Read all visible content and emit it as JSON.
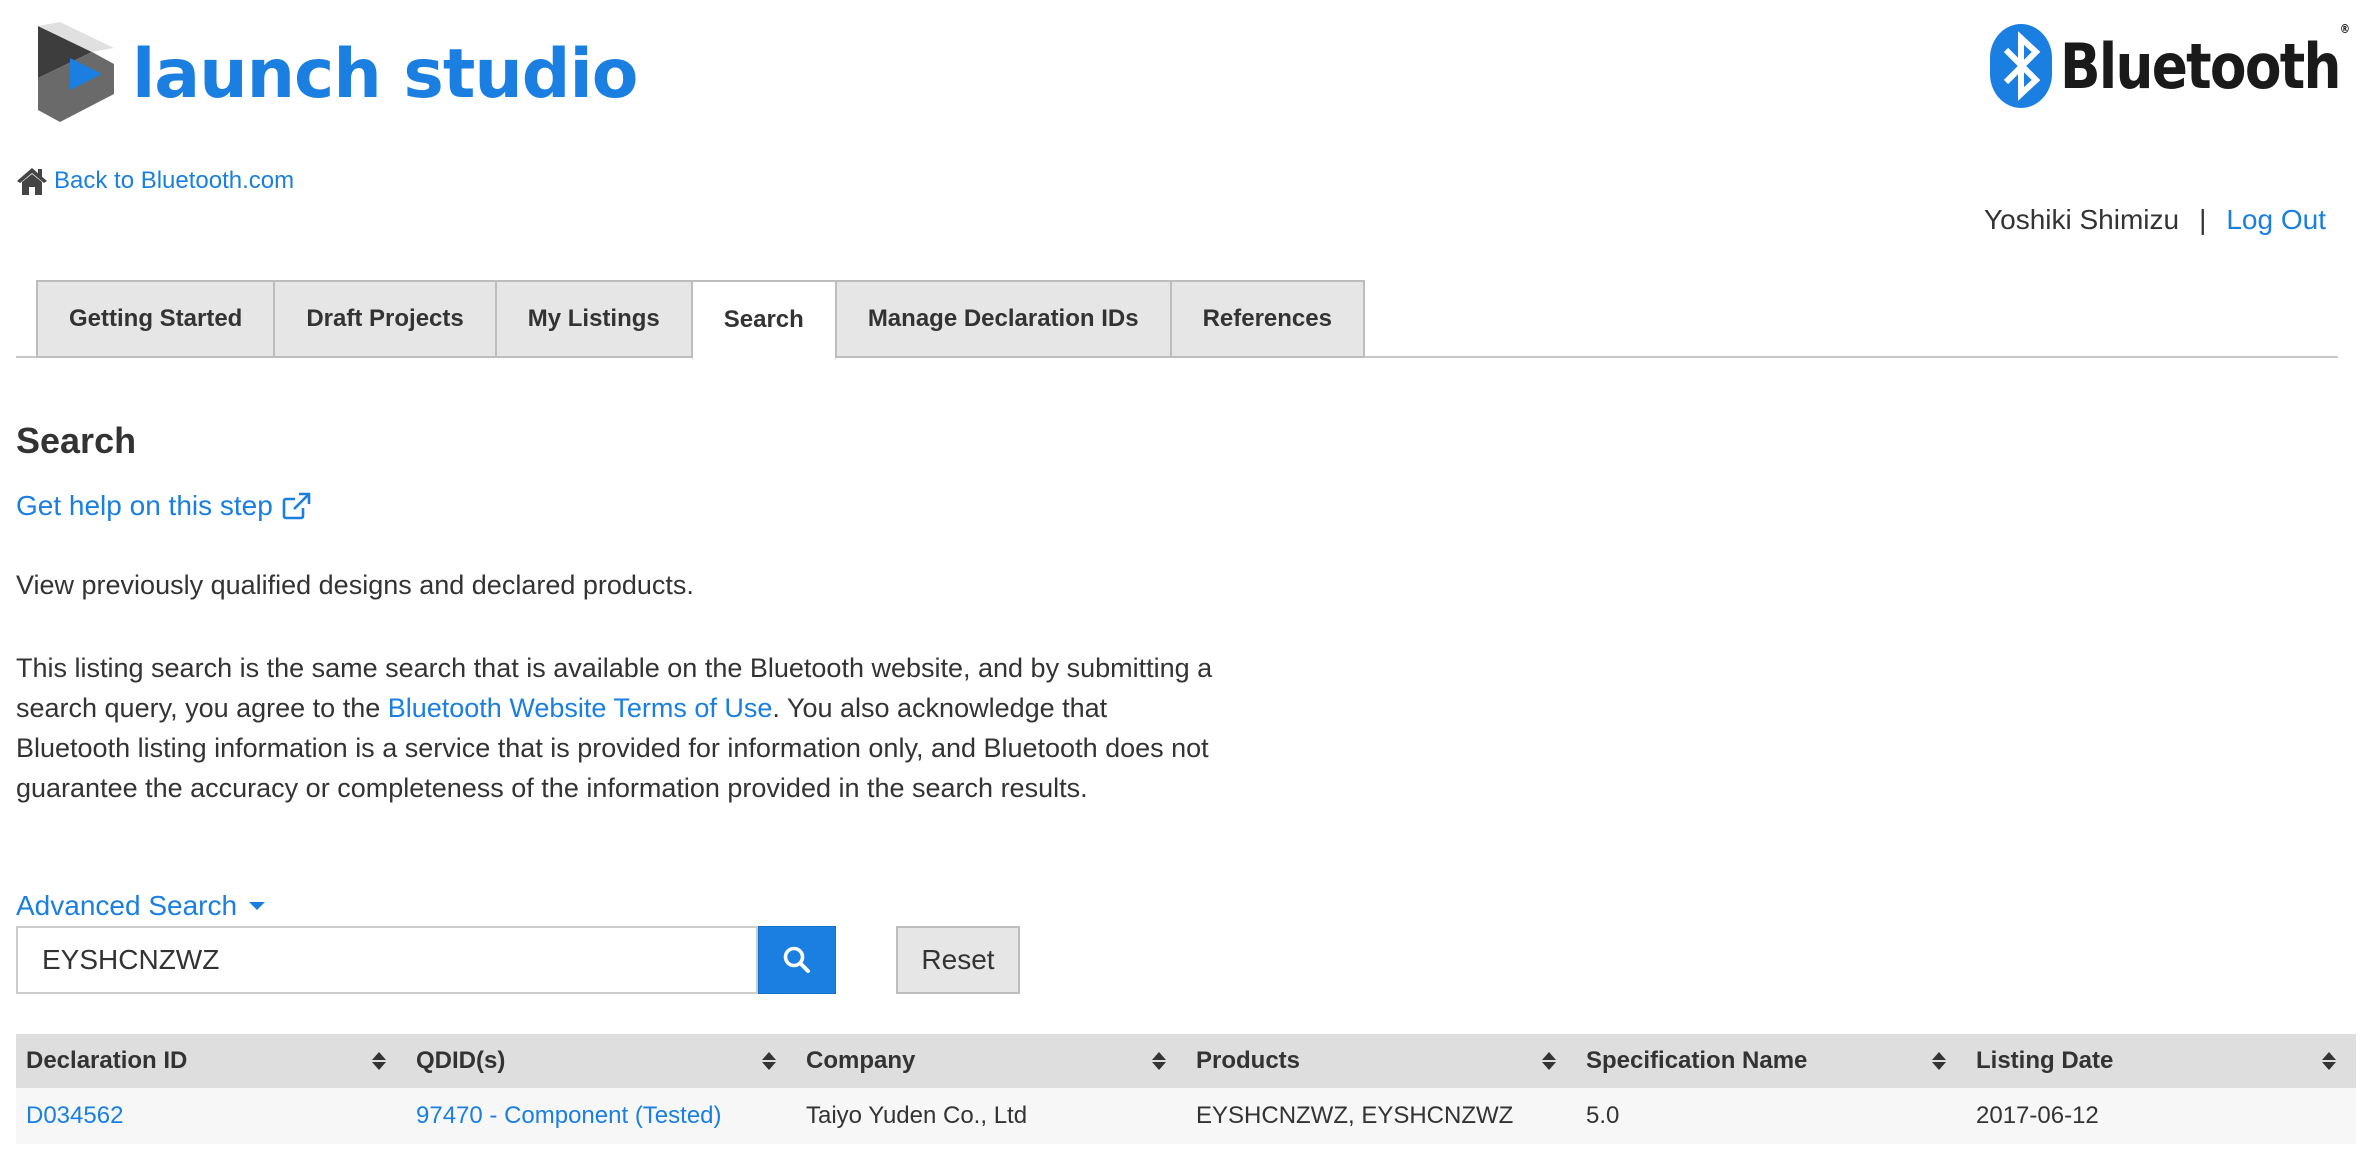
{
  "header": {
    "logo_text": "launch studio",
    "brand_logo_text": "Bluetooth",
    "brand_logo_mark": "®",
    "back_link": "Back to Bluetooth.com",
    "user_name": "Yoshiki Shimizu",
    "separator": "|",
    "logout_label": "Log Out"
  },
  "tabs": [
    {
      "label": "Getting Started"
    },
    {
      "label": "Draft Projects"
    },
    {
      "label": "My Listings"
    },
    {
      "label": "Search",
      "active": true
    },
    {
      "label": "Manage Declaration IDs"
    },
    {
      "label": "References"
    }
  ],
  "main": {
    "title": "Search",
    "help_link": "Get help on this step",
    "intro": "View previously qualified designs and declared products.",
    "disclaimer_part1": "This listing search is the same search that is available on the Bluetooth website, and by submitting a search query, you agree to the ",
    "disclaimer_link": "Bluetooth Website Terms of Use",
    "disclaimer_part2": ". You also acknowledge that Bluetooth listing information is a service that is provided for information only, and Bluetooth does not guarantee the accuracy or completeness of the information provided in the search results."
  },
  "search": {
    "advanced_label": "Advanced Search",
    "query": "EYSHCNZWZ",
    "reset_label": "Reset"
  },
  "table": {
    "columns": [
      "Declaration ID",
      "QDID(s)",
      "Company",
      "Products",
      "Specification Name",
      "Listing Date"
    ],
    "rows": [
      {
        "declaration_id": "D034562",
        "qdids": "97470 - Component (Tested)",
        "company": "Taiyo Yuden Co., Ltd",
        "products": "EYSHCNZWZ, EYSHCNZWZ",
        "spec_name": "5.0",
        "listing_date": "2017-06-12"
      }
    ]
  },
  "colors": {
    "accent": "#1a7fe0",
    "tab_bg": "#e6e6e6",
    "table_header_bg": "#dedede"
  },
  "icons": [
    "launch-studio-logo-icon",
    "bluetooth-rune-icon",
    "home-icon",
    "external-link-icon",
    "search-icon",
    "sort-icon",
    "caret-down-icon"
  ]
}
